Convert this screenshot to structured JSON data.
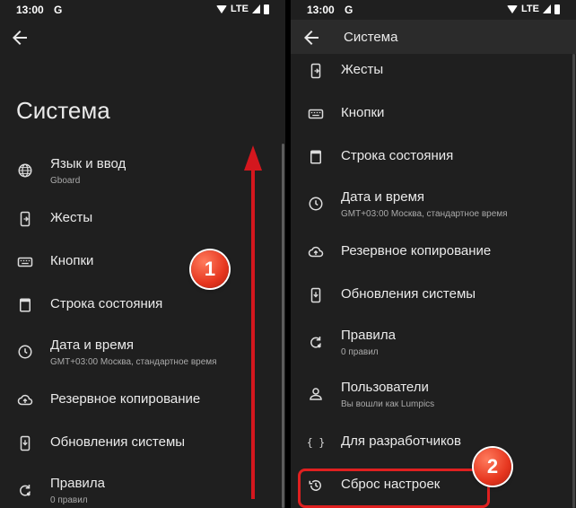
{
  "status_bar": {
    "time": "13:00",
    "google": "G",
    "network": "LTE"
  },
  "left_screen": {
    "title": "Система",
    "items": [
      {
        "label": "Язык и ввод",
        "sub": "Gboard",
        "icon": "globe-icon"
      },
      {
        "label": "Жесты",
        "icon": "gestures-icon"
      },
      {
        "label": "Кнопки",
        "icon": "keyboard-icon"
      },
      {
        "label": "Строка состояния",
        "icon": "status-bar-icon"
      },
      {
        "label": "Дата и время",
        "sub": "GMT+03:00 Москва, стандартное время",
        "icon": "clock-icon"
      },
      {
        "label": "Резервное копирование",
        "icon": "cloud-upload-icon"
      },
      {
        "label": "Обновления системы",
        "icon": "system-update-icon"
      },
      {
        "label": "Правила",
        "sub": "0 правил",
        "icon": "rules-icon"
      }
    ]
  },
  "right_screen": {
    "header_title": "Система",
    "items": [
      {
        "label": "Жесты",
        "icon": "gestures-icon"
      },
      {
        "label": "Кнопки",
        "icon": "keyboard-icon"
      },
      {
        "label": "Строка состояния",
        "icon": "status-bar-icon"
      },
      {
        "label": "Дата и время",
        "sub": "GMT+03:00 Москва, стандартное время",
        "icon": "clock-icon"
      },
      {
        "label": "Резервное копирование",
        "icon": "cloud-upload-icon"
      },
      {
        "label": "Обновления системы",
        "icon": "system-update-icon"
      },
      {
        "label": "Правила",
        "sub": "0 правил",
        "icon": "rules-icon"
      },
      {
        "label": "Пользователи",
        "sub": "Вы вошли как Lumpics",
        "icon": "person-icon"
      },
      {
        "label": "Для разработчиков",
        "icon": "braces-icon"
      },
      {
        "label": "Сброс настроек",
        "icon": "history-reset-icon"
      }
    ]
  },
  "annotations": {
    "step1": "1",
    "step2": "2"
  },
  "colors": {
    "background": "#1f1f1f",
    "header": "#2b2b2b",
    "accent_red": "#e02020"
  }
}
